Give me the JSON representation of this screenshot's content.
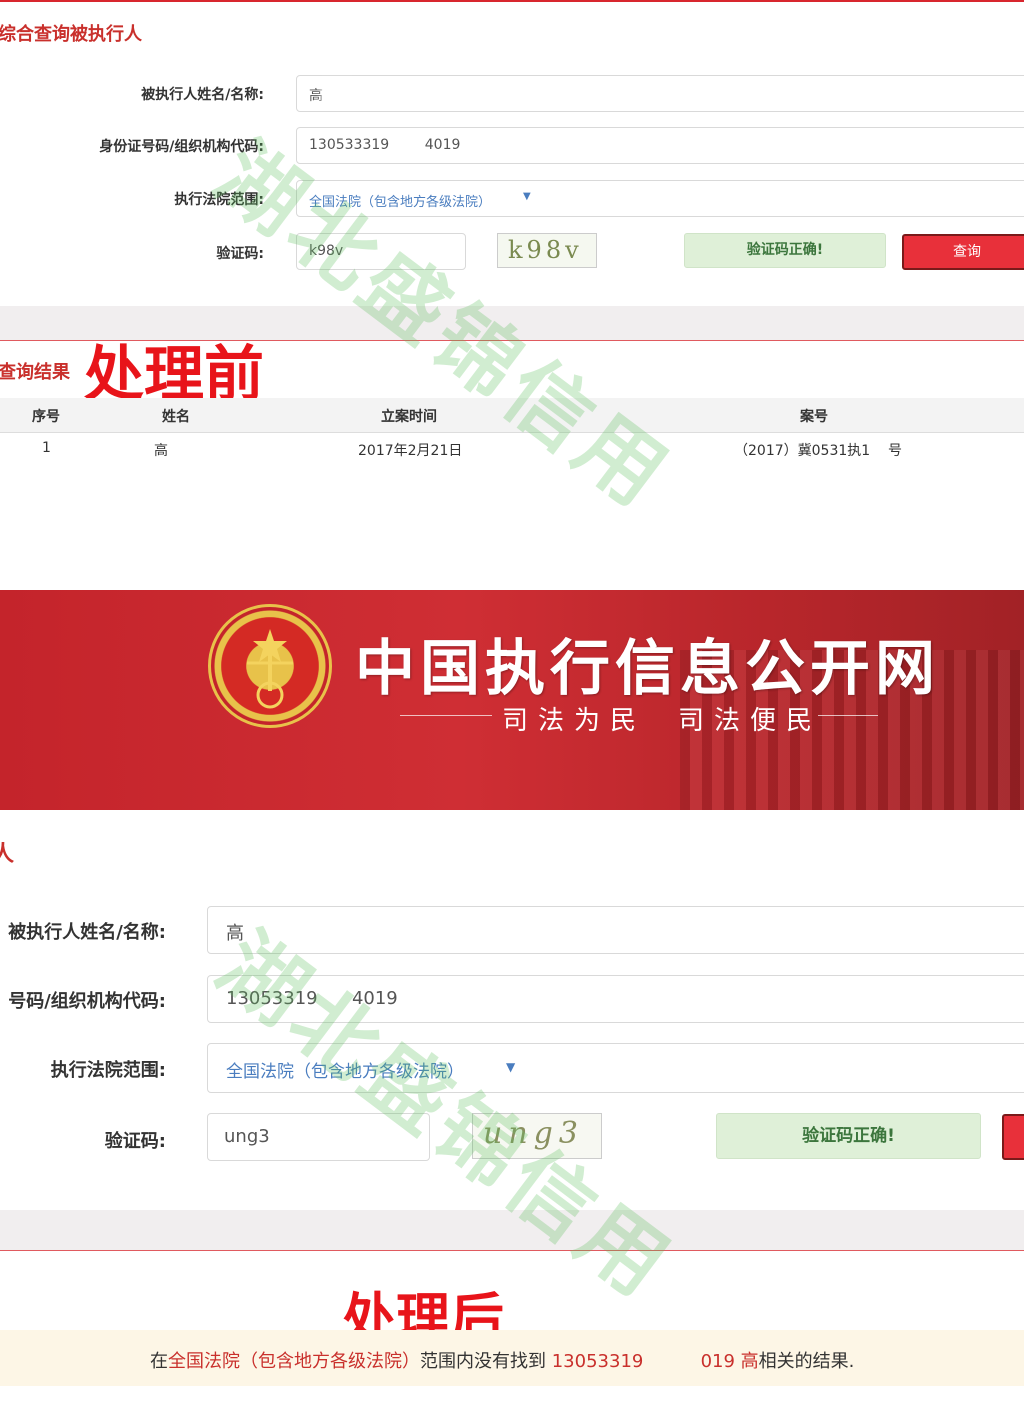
{
  "top": {
    "section_title": "综合查询被执行人",
    "labels": {
      "name": "被执行人姓名/名称:",
      "id": "身份证号码/组织机构代码:",
      "court": "执行法院范围:",
      "captcha": "验证码:"
    },
    "values": {
      "name": "高",
      "id": "130533319        4019",
      "court": "全国法院（包含地方各级法院）",
      "captcha_input": "k98v",
      "captcha_image": "k98v"
    },
    "verify_label": "验证码正确!",
    "query_label": "查询",
    "results_title": "查询结果",
    "before_label": "处理前",
    "table": {
      "headers": [
        "序号",
        "姓名",
        "立案时间",
        "案号"
      ],
      "rows": [
        {
          "no": "1",
          "name": "高",
          "date": "2017年2月21日",
          "case": "（2017）冀0531执1    号"
        }
      ]
    }
  },
  "banner": {
    "title": "中国执行信息公开网",
    "slogan_1": "司法为民",
    "slogan_2": "司法便民",
    "colors": {
      "bg": "#c8282e",
      "text": "#ffffff"
    }
  },
  "bottom": {
    "section_title_partial": "人",
    "labels": {
      "name": "被执行人姓名/名称:",
      "id": "号码/组织机构代码:",
      "court": "执行法院范围:",
      "captcha": "验证码:"
    },
    "values": {
      "name": "高",
      "id": "13053319      4019",
      "court": "全国法院（包含地方各级法院）",
      "captcha_input": "ung3",
      "captcha_image": "ung3"
    },
    "verify_label": "验证码正确!",
    "after_label": "处理后",
    "result_message": {
      "prefix": "在",
      "court": "全国法院（包含地方各级法院）",
      "middle": "范围内没有找到",
      "query": "13053319          019 高",
      "suffix": "相关的结果."
    }
  },
  "watermark": "湖北盛锦信用",
  "colors": {
    "accent_red": "#e8303a",
    "link_red": "#c9302c",
    "select_blue": "#4a7dbf"
  }
}
